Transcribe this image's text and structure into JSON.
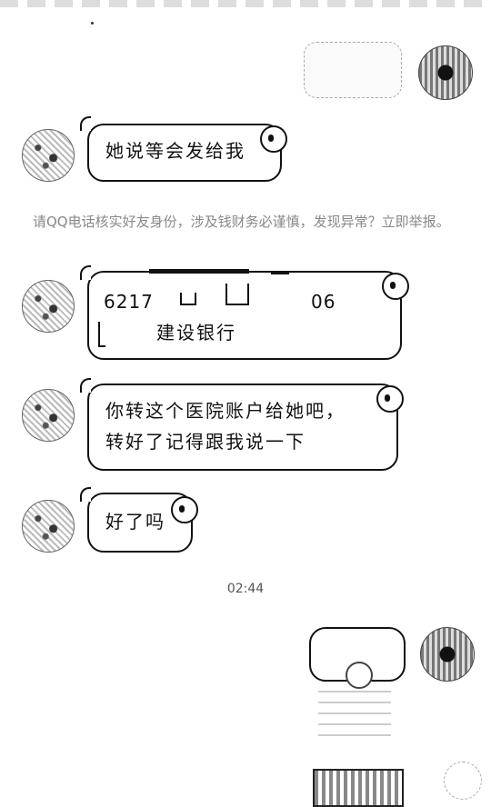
{
  "messages": {
    "m1": {
      "text": "她说等会发给我"
    },
    "notice": {
      "text": "请QQ电话核实好友身份，涉及钱财务必谨慎，发现异常？立即举报。"
    },
    "m2": {
      "card_number_prefix": "6217",
      "card_number_suffix": "06",
      "bank_name": "建设银行"
    },
    "m3": {
      "line1": "你转这个医院账户给她吧，",
      "line2": "转好了记得跟我说一下"
    },
    "m4": {
      "text": "好了吗"
    },
    "timestamp": "02:44"
  }
}
